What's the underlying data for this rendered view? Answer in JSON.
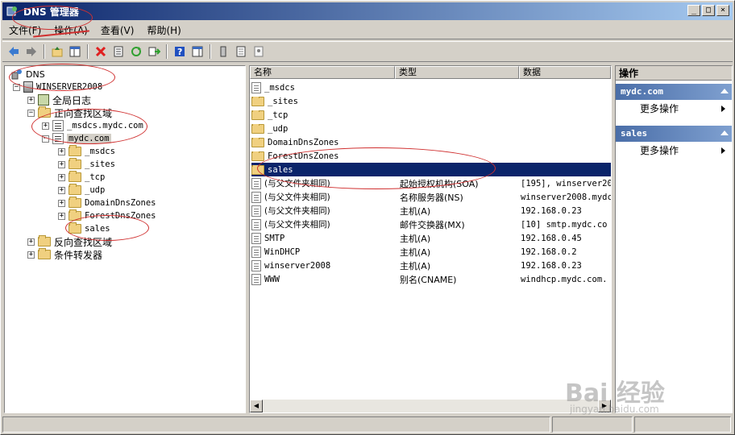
{
  "window": {
    "title": "DNS 管理器",
    "minimize": "_",
    "maximize": "□",
    "close": "×"
  },
  "menu": [
    "文件(F)",
    "操作(A)",
    "查看(V)",
    "帮助(H)"
  ],
  "tree": {
    "root": "DNS",
    "server": "WINSERVER2008",
    "global_log": "全局日志",
    "forward_zones": "正向查找区域",
    "msdcs_zone": "_msdcs.mydc.com",
    "mydc_zone": "mydc.com",
    "subfolders": [
      "_msdcs",
      "_sites",
      "_tcp",
      "_udp",
      "DomainDnsZones",
      "ForestDnsZones",
      "sales"
    ],
    "reverse_zones": "反向查找区域",
    "conditional_forwarders": "条件转发器"
  },
  "list": {
    "columns": [
      "名称",
      "类型",
      "数据"
    ],
    "rows": [
      {
        "name": "_msdcs",
        "type": "",
        "data": "",
        "icon": "zone-icon"
      },
      {
        "name": "_sites",
        "type": "",
        "data": "",
        "icon": "folder-icon"
      },
      {
        "name": "_tcp",
        "type": "",
        "data": "",
        "icon": "folder-icon"
      },
      {
        "name": "_udp",
        "type": "",
        "data": "",
        "icon": "folder-icon"
      },
      {
        "name": "DomainDnsZones",
        "type": "",
        "data": "",
        "icon": "folder-icon"
      },
      {
        "name": "ForestDnsZones",
        "type": "",
        "data": "",
        "icon": "folder-icon"
      },
      {
        "name": "sales",
        "type": "",
        "data": "",
        "icon": "folder-icon",
        "selected": true
      },
      {
        "name": "(与父文件夹相同)",
        "type": "起始授权机构(SOA)",
        "data": "[195], winserver200",
        "icon": "record-icon"
      },
      {
        "name": "(与父文件夹相同)",
        "type": "名称服务器(NS)",
        "data": "winserver2008.mydc.",
        "icon": "record-icon"
      },
      {
        "name": "(与父文件夹相同)",
        "type": "主机(A)",
        "data": "192.168.0.23",
        "icon": "record-icon"
      },
      {
        "name": "(与父文件夹相同)",
        "type": "邮件交换器(MX)",
        "data": "[10]  smtp.mydc.co",
        "icon": "record-icon"
      },
      {
        "name": "SMTP",
        "type": "主机(A)",
        "data": "192.168.0.45",
        "icon": "record-icon"
      },
      {
        "name": "WinDHCP",
        "type": "主机(A)",
        "data": "192.168.0.2",
        "icon": "record-icon"
      },
      {
        "name": "winserver2008",
        "type": "主机(A)",
        "data": "192.168.0.23",
        "icon": "record-icon"
      },
      {
        "name": "WWW",
        "type": "别名(CNAME)",
        "data": "windhcp.mydc.com.",
        "icon": "record-icon"
      }
    ]
  },
  "actions": {
    "title": "操作",
    "sections": [
      {
        "header": "mydc.com",
        "item": "更多操作"
      },
      {
        "header": "sales",
        "item": "更多操作"
      }
    ]
  },
  "watermark": {
    "main": "Bai 经验",
    "sub": "jingyan.baidu.com"
  },
  "colors": {
    "title_bar": "#0a246a",
    "selection": "#0a246a",
    "annotation": "#d03030",
    "action_header": "#4a6ea8"
  }
}
